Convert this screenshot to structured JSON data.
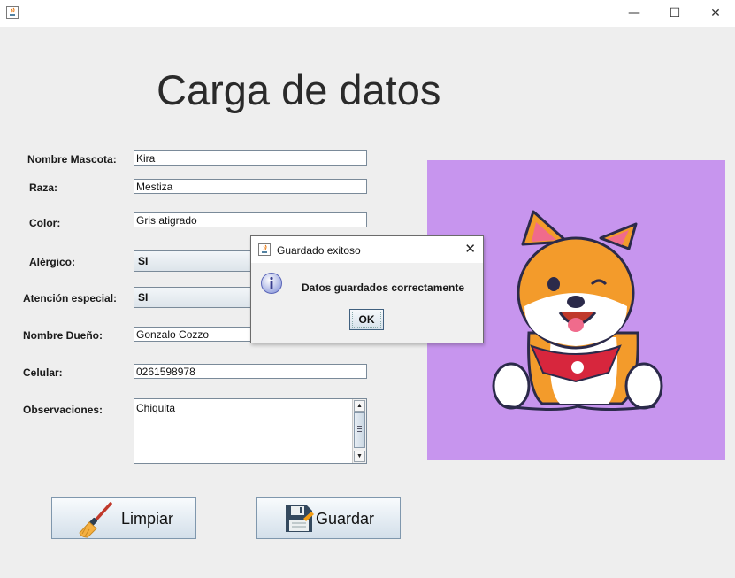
{
  "window": {
    "title": "",
    "controls": {
      "minimize": "—",
      "maximize": "☐",
      "close": "✕"
    }
  },
  "heading": "Carga de datos",
  "form": {
    "fields": [
      {
        "label": "Nombre Mascota:",
        "value": "Kira"
      },
      {
        "label": "Raza:",
        "value": "Mestiza"
      },
      {
        "label": "Color:",
        "value": "Gris atigrado"
      },
      {
        "label": "Alérgico:",
        "value": "SI"
      },
      {
        "label": "Atención especial:",
        "value": "SI"
      },
      {
        "label": "Nombre Dueño:",
        "value": "Gonzalo Cozzo"
      },
      {
        "label": "Celular:",
        "value": "0261598978"
      },
      {
        "label": "Observaciones:",
        "value": "Chiquita"
      }
    ]
  },
  "buttons": {
    "clear": {
      "label": "Limpiar",
      "icon": "broom-icon"
    },
    "save": {
      "label": "Guardar",
      "icon": "floppy-disk-icon"
    }
  },
  "image": {
    "subject": "corgi-puppy-illustration",
    "background": "#c795ee"
  },
  "dialog": {
    "title": "Guardado exitoso",
    "message": "Datos guardados correctamente",
    "ok_label": "OK",
    "close": "✕",
    "icon": "info-icon"
  }
}
